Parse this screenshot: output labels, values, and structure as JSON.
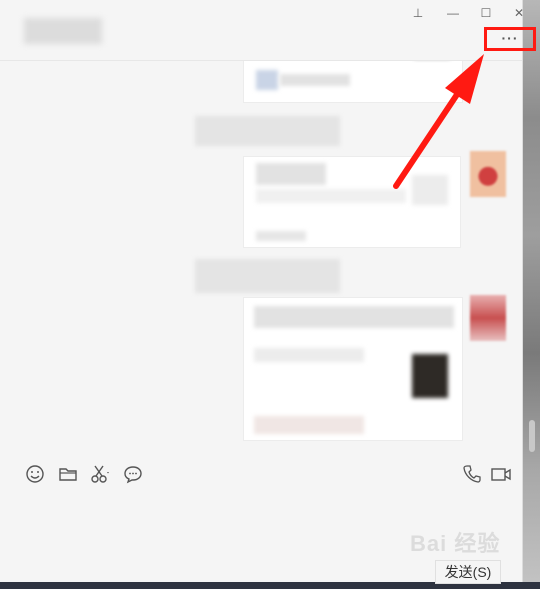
{
  "window": {
    "controls": {
      "pin": "⊥",
      "minimize": "—",
      "maximize": "☐",
      "close": "✕"
    },
    "more_label": "···"
  },
  "toolbar": {
    "icons": [
      "emoji-icon",
      "folder-icon",
      "scissors-icon",
      "chat-bubble-icon",
      "phone-icon",
      "video-icon"
    ]
  },
  "send_button": {
    "label": "发送(S)"
  },
  "watermark": {
    "text": "Bai 经验"
  },
  "colors": {
    "highlight": "#ff1a12",
    "background": "#f5f5f5"
  }
}
